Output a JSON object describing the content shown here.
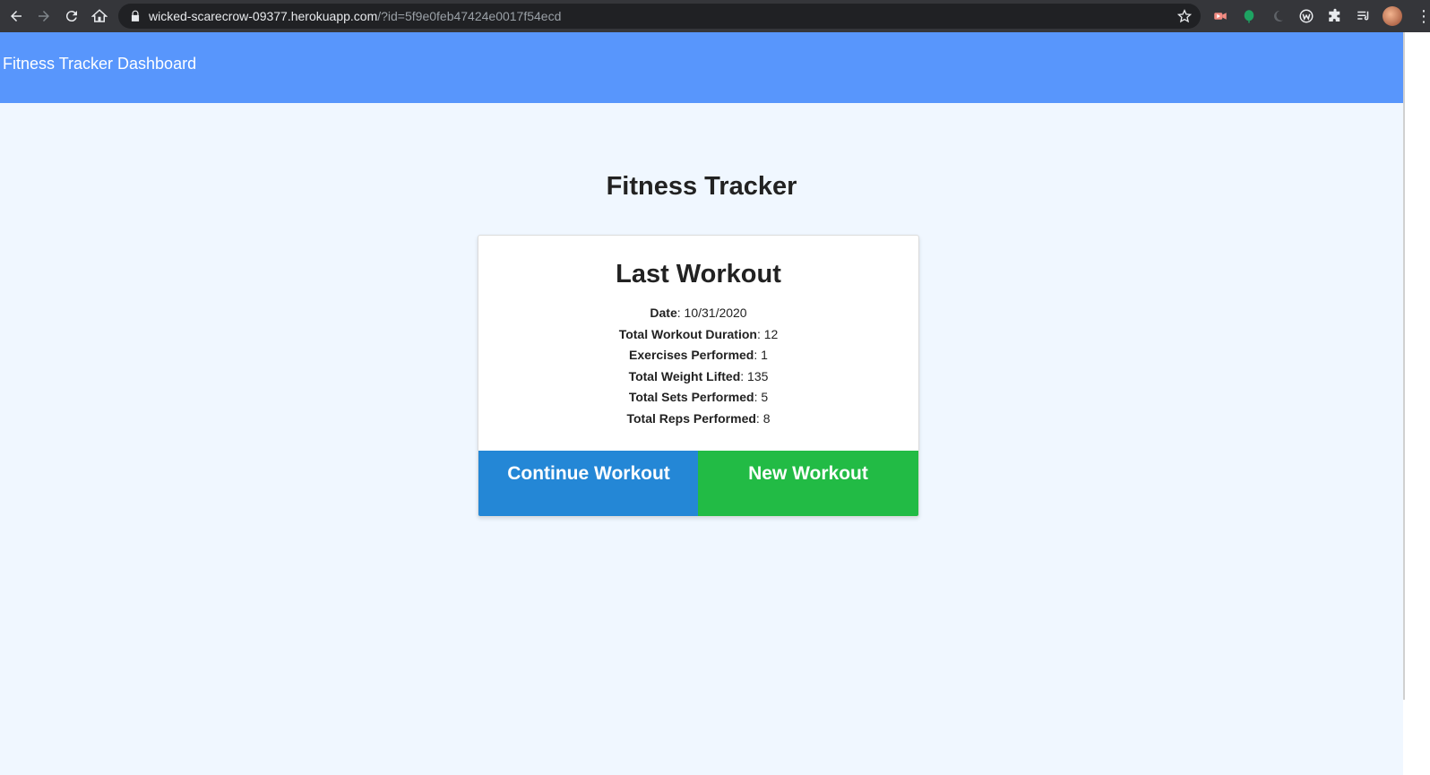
{
  "browser": {
    "url_host": "wicked-scarecrow-09377.herokuapp.com",
    "url_rest": "/?id=5f9e0feb47424e0017f54ecd",
    "nav_icons": [
      "back-icon",
      "forward-icon",
      "reload-icon",
      "home-icon"
    ],
    "extension_icons": [
      "video-extension-icon",
      "leaf-extension-icon",
      "moon-extension-icon",
      "w-extension-icon",
      "puzzle-extensions-icon",
      "reading-list-icon"
    ]
  },
  "navbar": {
    "brand": "Fitness Tracker Dashboard",
    "color": "#5896fc"
  },
  "page": {
    "title": "Fitness Tracker"
  },
  "last_workout": {
    "title": "Last Workout",
    "stats": [
      {
        "label": "Date",
        "value": ": 10/31/2020"
      },
      {
        "label": "Total Workout Duration",
        "value": ": 12"
      },
      {
        "label": "Exercises Performed",
        "value": ": 1"
      },
      {
        "label": "Total Weight Lifted",
        "value": ": 135"
      },
      {
        "label": "Total Sets Performed",
        "value": ": 5"
      },
      {
        "label": "Total Reps Performed",
        "value": ": 8"
      }
    ]
  },
  "actions": {
    "continue_label": "Continue Workout",
    "new_label": "New Workout",
    "continue_color": "#2487d6",
    "new_color": "#22bb45"
  }
}
